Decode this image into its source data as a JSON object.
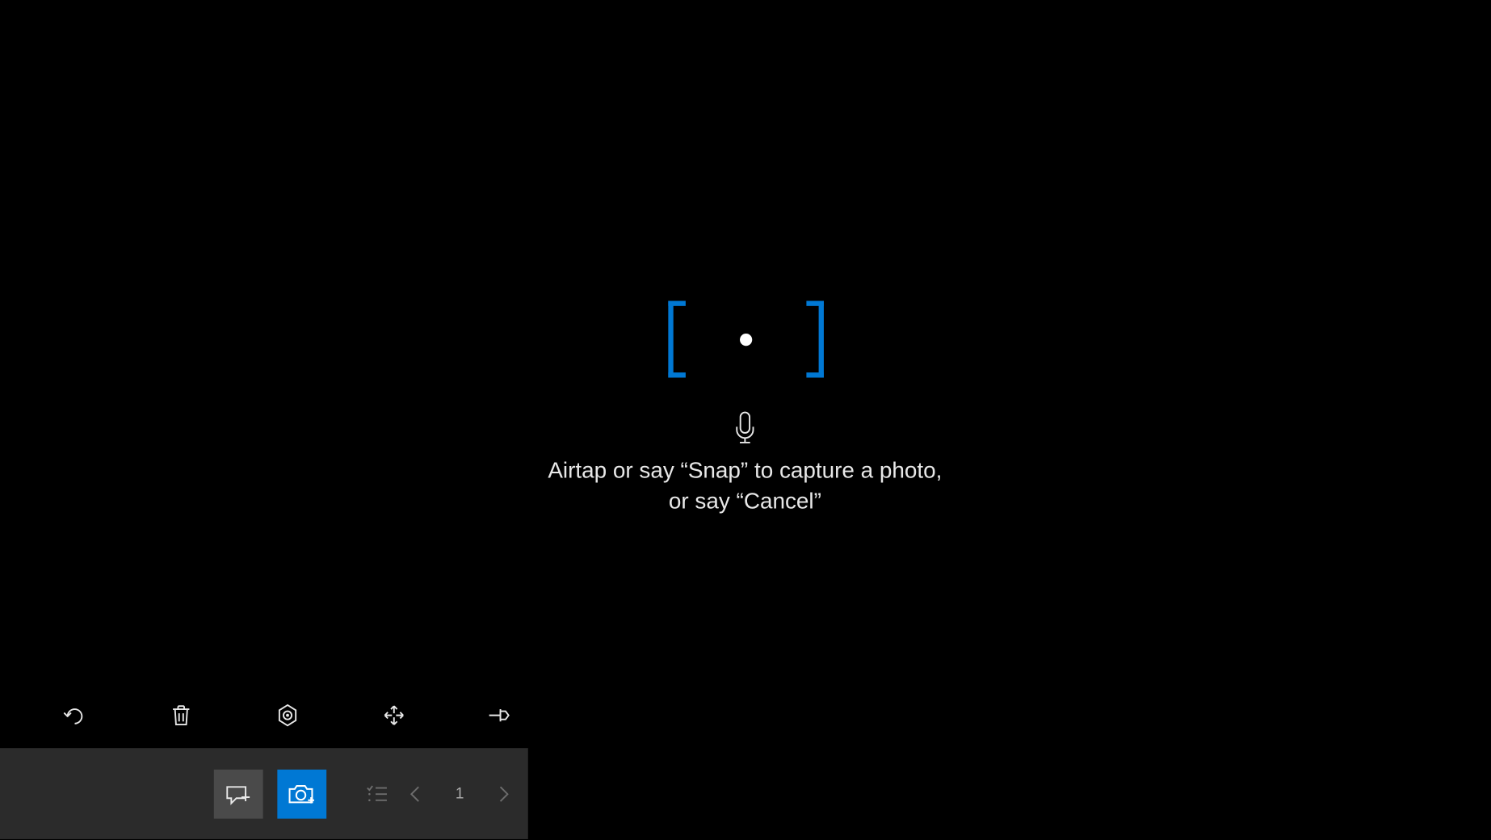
{
  "viewfinder": {
    "bracket_color": "#0078d4"
  },
  "instructions": {
    "line1": "Airtap or say “Snap” to capture a photo,",
    "line2": "or say “Cancel”"
  },
  "tool_row": {
    "undo": "undo",
    "delete": "delete",
    "locate": "locate",
    "move": "move",
    "pin": "pin"
  },
  "bottom_panel": {
    "page_number": "1",
    "annotate_icon": "annotate",
    "camera_icon": "camera",
    "list_icon": "list",
    "prev_icon": "previous",
    "next_icon": "next"
  }
}
